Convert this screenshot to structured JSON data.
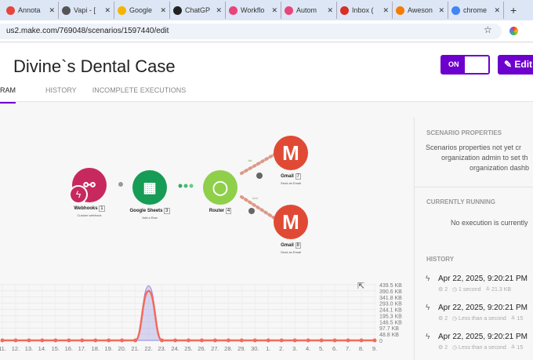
{
  "browser": {
    "tabs": [
      {
        "label": "Annota",
        "color": "#e8453c"
      },
      {
        "label": "Vapi - [",
        "color": "#555"
      },
      {
        "label": "Google",
        "color": "#f4b400"
      },
      {
        "label": "ChatGP",
        "color": "#222"
      },
      {
        "label": "Workflo",
        "color": "#e8457a"
      },
      {
        "label": "Autom",
        "color": "#e8457a"
      },
      {
        "label": "Inbox (",
        "color": "#d93025"
      },
      {
        "label": "Aweson",
        "color": "#f57c00"
      },
      {
        "label": "chrome",
        "color": "#4285f4"
      }
    ],
    "url": "us2.make.com/769048/scenarios/1597440/edit"
  },
  "header": {
    "title": "Divine`s Dental Case",
    "toggle_label": "ON",
    "edit_label": "Edit",
    "accent": "#6d00cc"
  },
  "tabs": [
    "RAM",
    "HISTORY",
    "INCOMPLETE EXECUTIONS"
  ],
  "modules": [
    {
      "name": "Webhooks",
      "id": "1",
      "sub": "Custom webhook",
      "color": "#c7295f"
    },
    {
      "name": "Google Sheets",
      "id": "3",
      "sub": "Add a Row",
      "color": "#169c55"
    },
    {
      "name": "Router",
      "id": "4",
      "sub": "",
      "color": "#8fcf4a"
    },
    {
      "name": "Gmail",
      "id": "7",
      "sub": "Send an Email",
      "color": "#e04a35"
    },
    {
      "name": "Gmail",
      "id": "8",
      "sub": "Send an Email",
      "color": "#e04a35"
    }
  ],
  "routes": [
    "1st",
    "2nd"
  ],
  "panel": {
    "scenario_properties": "SCENARIO PROPERTIES",
    "props_text": [
      "Scenarios properties not yet cr",
      "organization admin to set th",
      "organization dashb"
    ],
    "currently_running": "CURRENTLY RUNNING",
    "running_text": "No execution is currently",
    "history": "HISTORY",
    "items": [
      {
        "date": "Apr 22, 2025, 9:20:21 PM",
        "ops": "2",
        "duration": "1 second",
        "size": "21.3 KB"
      },
      {
        "date": "Apr 22, 2025, 9:20:21 PM",
        "ops": "2",
        "duration": "Less than a second",
        "size": "15"
      },
      {
        "date": "Apr 22, 2025, 9:20:21 PM",
        "ops": "2",
        "duration": "Less than a second",
        "size": "15"
      }
    ]
  },
  "chart_data": {
    "type": "line",
    "categories": [
      "11.",
      "12.",
      "13.",
      "14.",
      "15.",
      "16.",
      "17.",
      "18.",
      "19.",
      "20.",
      "21.",
      "22.",
      "23.",
      "24.",
      "25.",
      "26.",
      "27.",
      "28.",
      "29.",
      "30.",
      "1.",
      "2.",
      "3.",
      "4.",
      "5.",
      "6.",
      "7.",
      "8.",
      "9."
    ],
    "series": [
      {
        "values": [
          0,
          0,
          0,
          0,
          0,
          0,
          0,
          0,
          0,
          0,
          0,
          390,
          0,
          0,
          0,
          0,
          0,
          0,
          0,
          0,
          0,
          0,
          0,
          0,
          0,
          0,
          0,
          0,
          0
        ],
        "color": "#f26b5b",
        "style": "line"
      },
      {
        "values": [
          0,
          0,
          0,
          0,
          0,
          0,
          0,
          0,
          0,
          0,
          0,
          430,
          0,
          0,
          0,
          0,
          0,
          0,
          0,
          0,
          0,
          0,
          0,
          0,
          0,
          0,
          0,
          0,
          0
        ],
        "color": "#8f86e0",
        "style": "area"
      }
    ],
    "y_ticks": [
      "439.5 KB",
      "390.6 KB",
      "341.8 KB",
      "293.0 KB",
      "244.1 KB",
      "195.3 KB",
      "146.5 KB",
      "97.7 KB",
      "48.8 KB",
      "0"
    ],
    "ylim": [
      0,
      439.5
    ],
    "grid": true,
    "y_axis": "right"
  }
}
